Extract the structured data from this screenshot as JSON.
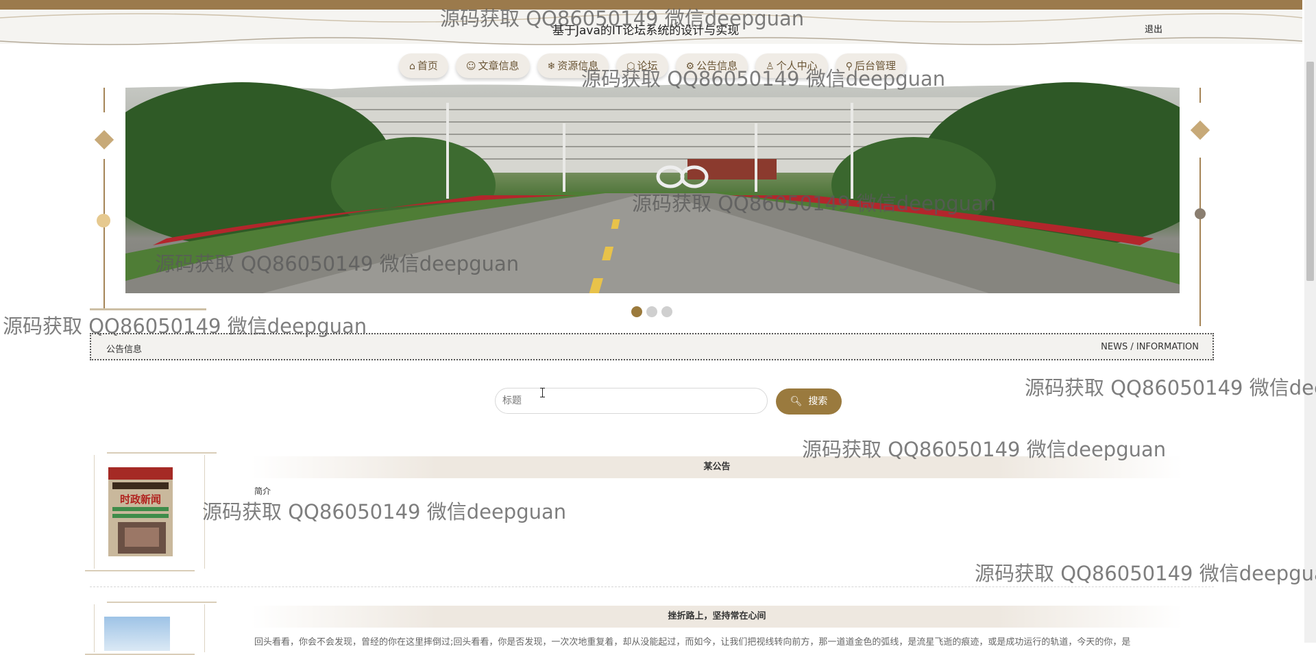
{
  "header": {
    "title": "基于Java的IT论坛系统的设计与实现",
    "logout_label": "退出"
  },
  "nav": {
    "items": [
      {
        "icon": "home-icon",
        "glyph": "⌂",
        "label": "首页"
      },
      {
        "icon": "smile-icon",
        "glyph": "☺",
        "label": "文章信息"
      },
      {
        "icon": "snowflake-icon",
        "glyph": "❄",
        "label": "资源信息"
      },
      {
        "icon": "cube-icon",
        "glyph": "⬡",
        "label": "论坛"
      },
      {
        "icon": "gear-icon",
        "glyph": "⚙",
        "label": "公告信息"
      },
      {
        "icon": "user-icon",
        "glyph": "♙",
        "label": "个人中心"
      },
      {
        "icon": "link-icon",
        "glyph": "⚲",
        "label": "后台管理"
      }
    ]
  },
  "carousel": {
    "slide_count": 3,
    "active_index": 0
  },
  "section": {
    "title": "公告信息",
    "subtitle": "NEWS / INFORMATION"
  },
  "search": {
    "placeholder": "标题",
    "button_label": "搜索"
  },
  "notices": [
    {
      "title": "某公告",
      "label": "简介",
      "thumb_text": "时政新闻"
    },
    {
      "title": "挫折路上，坚持常在心间",
      "summary": "回头看看，你会不会发现，曾经的你在这里摔倒过;回头看看，你是否发现，一次次地重复着，却从没能起过，而如今，让我们把视线转向前方，那一道道金色的弧线，是流星飞逝的痕迹，或是成功运行的轨道，今天的你，是"
    }
  ],
  "watermark": "源码获取 QQ86050149 微信deepguan",
  "colors": {
    "accent": "#9b7a3c",
    "nav_bg": "#f0ece6",
    "section_bg": "#f3f2ef"
  }
}
